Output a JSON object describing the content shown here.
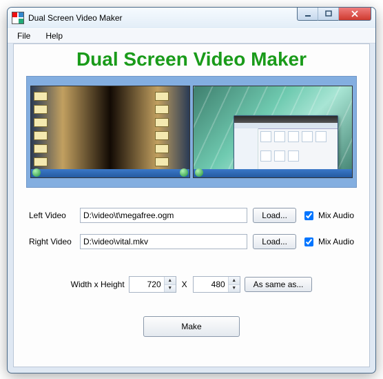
{
  "window": {
    "title": "Dual Screen Video Maker"
  },
  "menu": {
    "file": "File",
    "help": "Help"
  },
  "banner": "Dual Screen Video Maker",
  "left": {
    "label": "Left Video",
    "path": "D:\\video\\t\\megafree.ogm",
    "load": "Load...",
    "mix": "Mix Audio",
    "mix_checked": true
  },
  "right": {
    "label": "Right Video",
    "path": "D:\\video\\vital.mkv",
    "load": "Load...",
    "mix": "Mix Audio",
    "mix_checked": true
  },
  "dim": {
    "label": "Width x Height",
    "width": "720",
    "sep": "X",
    "height": "480",
    "same": "As same as..."
  },
  "make": "Make"
}
